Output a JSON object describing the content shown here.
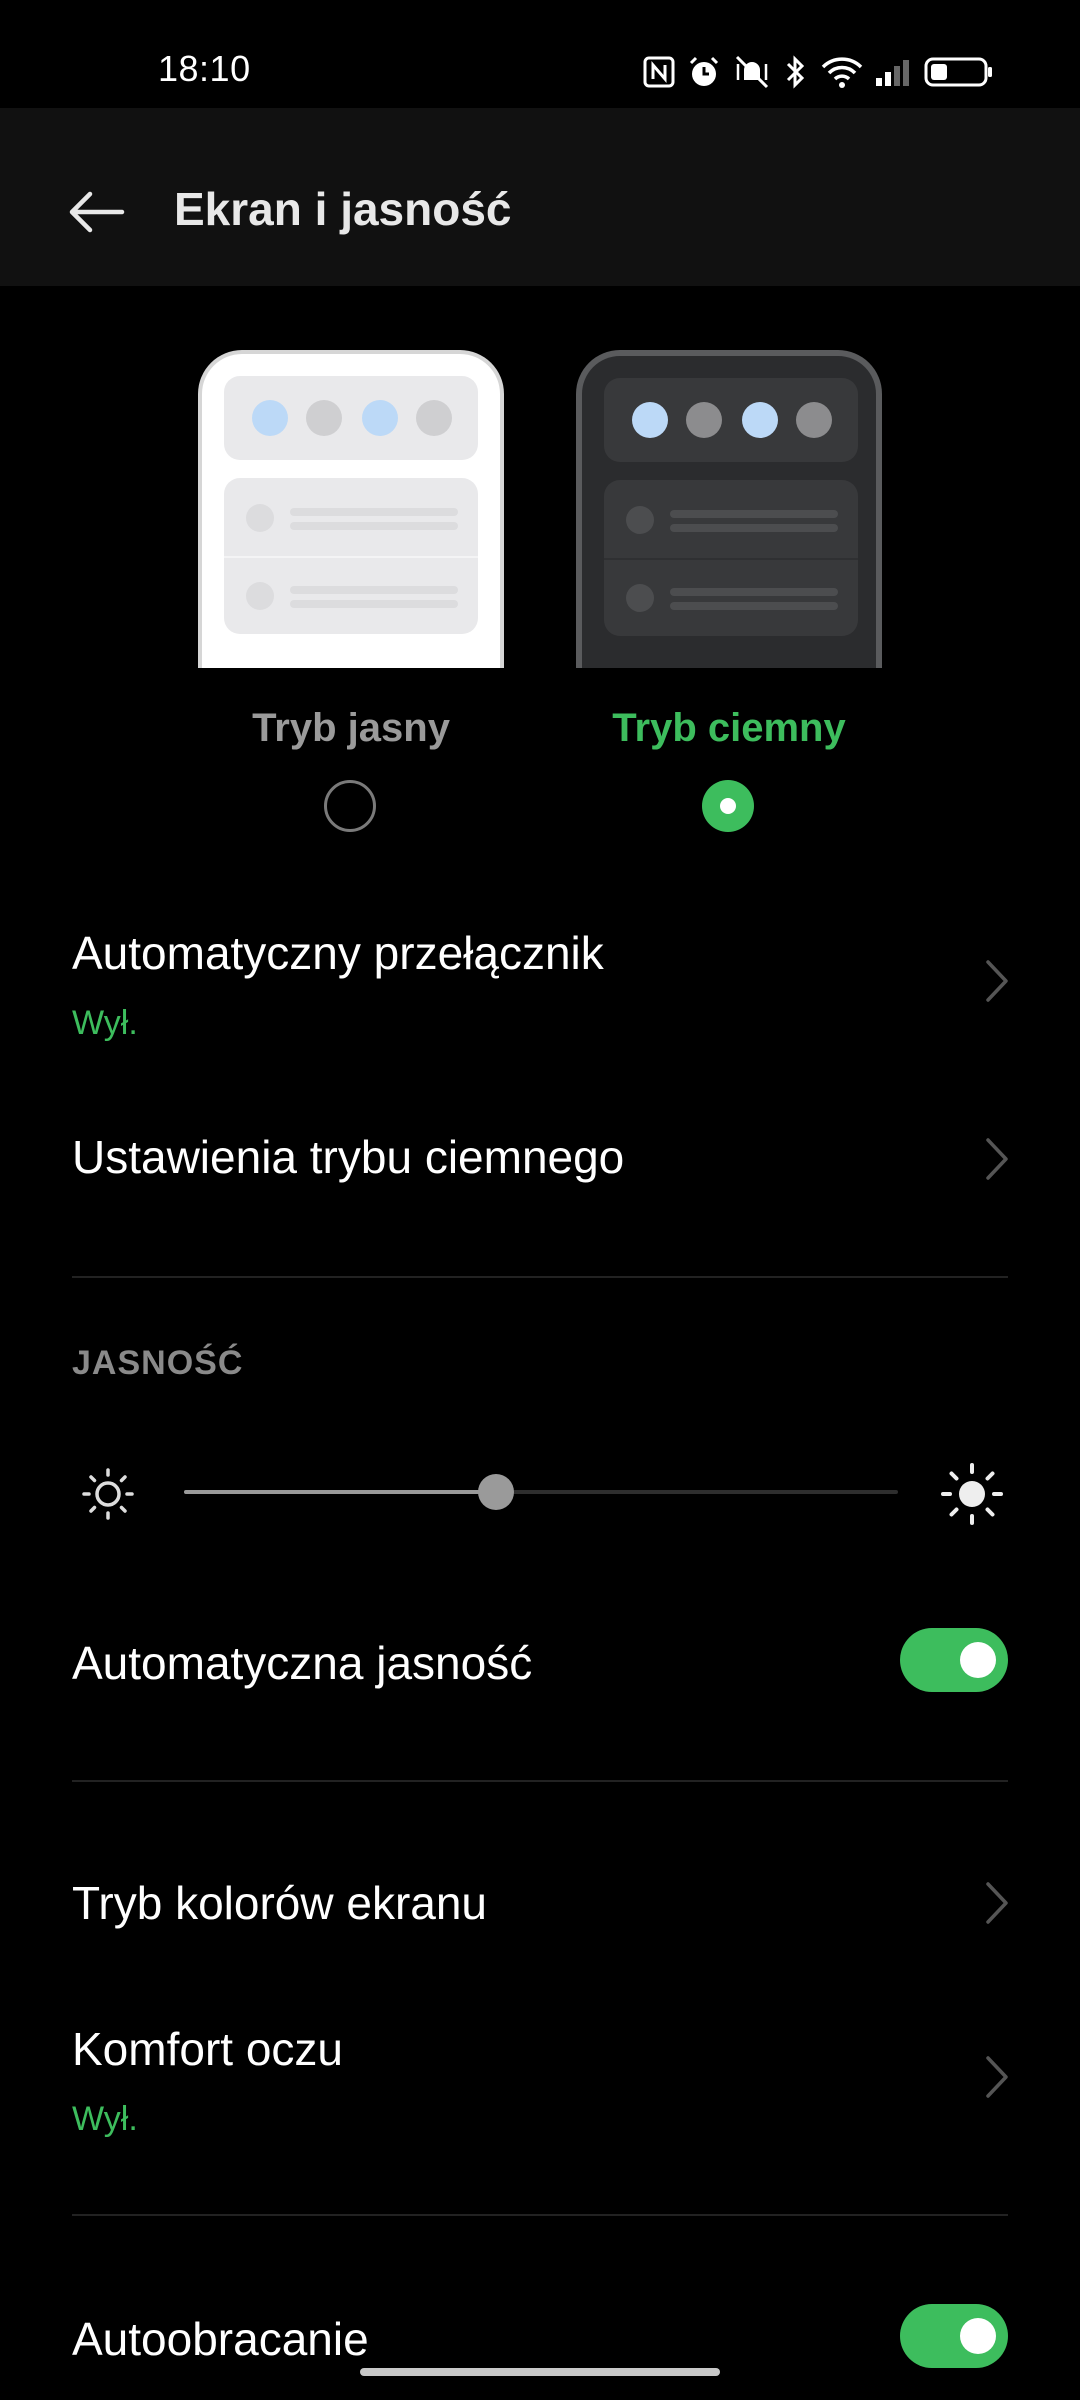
{
  "status": {
    "time": "18:10"
  },
  "header": {
    "title": "Ekran i jasność"
  },
  "modes": {
    "light_label": "Tryb jasny",
    "dark_label": "Tryb ciemny",
    "selected": "dark"
  },
  "settings": {
    "auto_switch": {
      "title": "Automatyczny przełącznik",
      "value": "Wył."
    },
    "dark_mode_settings": {
      "title": "Ustawienia trybu ciemnego"
    },
    "brightness_section": "JASNOŚĆ",
    "brightness_level": 0.44,
    "auto_brightness": {
      "title": "Automatyczna jasność",
      "on": true
    },
    "color_mode": {
      "title": "Tryb kolorów ekranu"
    },
    "eye_comfort": {
      "title": "Komfort oczu",
      "value": "Wył."
    },
    "auto_rotate": {
      "title": "Autoobracanie",
      "on": true
    }
  },
  "colors": {
    "accent": "#3dbd5d",
    "background": "#000000",
    "appbar": "#111111"
  }
}
